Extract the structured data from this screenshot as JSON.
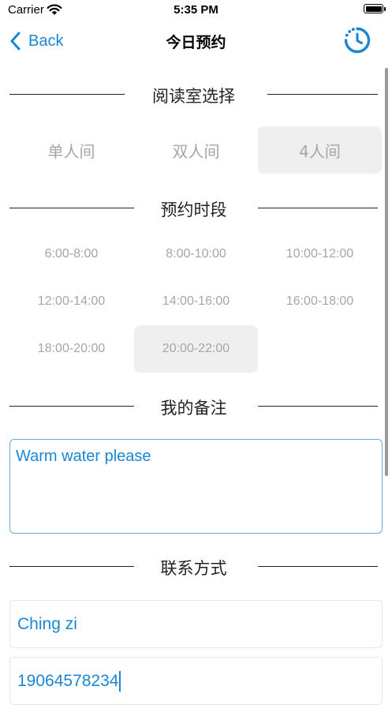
{
  "status_bar": {
    "carrier": "Carrier",
    "time": "5:35 PM"
  },
  "nav": {
    "back_label": "Back",
    "title": "今日预约"
  },
  "sections": {
    "room": "阅读室选择",
    "time_slot": "预约时段",
    "note": "我的备注",
    "contact": "联系方式"
  },
  "rooms": [
    {
      "label": "单人间",
      "selected": false
    },
    {
      "label": "双人间",
      "selected": false
    },
    {
      "label": "4人间",
      "selected": true
    }
  ],
  "time_slots": [
    {
      "label": "6:00-8:00",
      "selected": false
    },
    {
      "label": "8:00-10:00",
      "selected": false
    },
    {
      "label": "10:00-12:00",
      "selected": false
    },
    {
      "label": "12:00-14:00",
      "selected": false
    },
    {
      "label": "14:00-16:00",
      "selected": false
    },
    {
      "label": "16:00-18:00",
      "selected": false
    },
    {
      "label": "18:00-20:00",
      "selected": false
    },
    {
      "label": "20:00-22:00",
      "selected": true
    }
  ],
  "note_text": "Warm water please",
  "contact": {
    "name": "Ching zi",
    "phone": "19064578234"
  },
  "colors": {
    "accent": "#1b86d6",
    "inactive_text": "#a6a6a6",
    "selected_bg": "#efefef"
  }
}
